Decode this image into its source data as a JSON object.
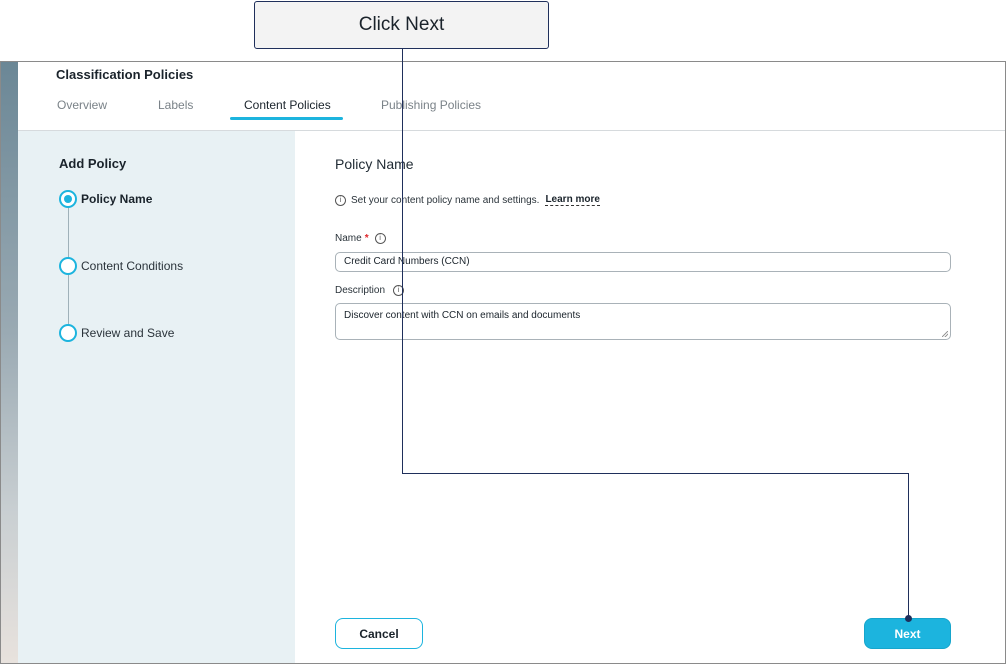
{
  "callout": {
    "text": "Click Next"
  },
  "header": {
    "title": "Classification Policies",
    "tabs": [
      {
        "label": "Overview",
        "active": false
      },
      {
        "label": "Labels",
        "active": false
      },
      {
        "label": "Content Policies",
        "active": true
      },
      {
        "label": "Publishing Policies",
        "active": false
      }
    ]
  },
  "sidebar": {
    "title": "Add Policy",
    "steps": [
      {
        "label": "Policy Name",
        "active": true
      },
      {
        "label": "Content Conditions",
        "active": false
      },
      {
        "label": "Review and Save",
        "active": false
      }
    ]
  },
  "form": {
    "section_title": "Policy Name",
    "info_text": "Set your content policy name and settings.",
    "learn_more": "Learn more",
    "name_label": "Name",
    "required_mark": "*",
    "name_value": "Credit Card Numbers (CCN)",
    "description_label": "Description",
    "description_value": "Discover content with CCN on emails and documents"
  },
  "footer": {
    "cancel_label": "Cancel",
    "next_label": "Next"
  },
  "colors": {
    "accent": "#1cb4de",
    "sidebar_bg": "#e8f1f4",
    "callout_border": "#1f2f5b",
    "required": "#e0262a"
  }
}
